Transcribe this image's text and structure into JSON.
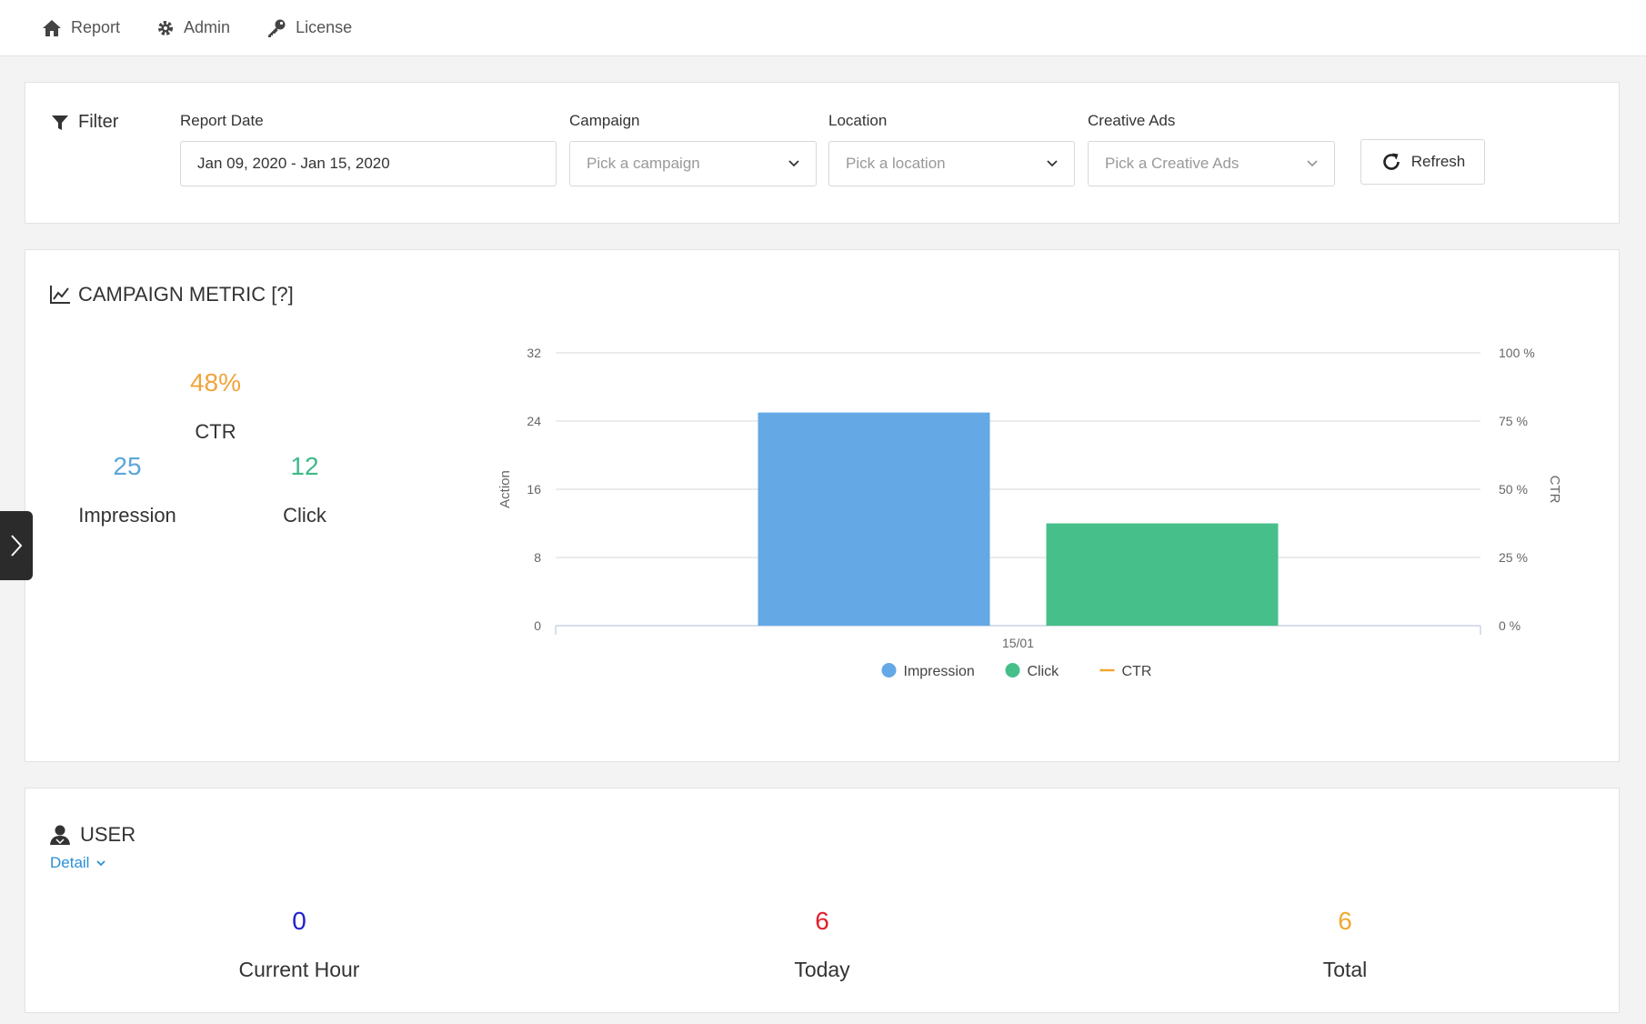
{
  "nav": {
    "items": [
      {
        "label": "Report",
        "icon": "home-icon"
      },
      {
        "label": "Admin",
        "icon": "gear-icon"
      },
      {
        "label": "License",
        "icon": "key-icon"
      }
    ]
  },
  "filter": {
    "title": "Filter",
    "report_date": {
      "label": "Report Date",
      "value": "Jan 09, 2020 - Jan 15, 2020"
    },
    "campaign": {
      "label": "Campaign",
      "placeholder": "Pick a campaign"
    },
    "location": {
      "label": "Location",
      "placeholder": "Pick a location"
    },
    "creative_ads": {
      "label": "Creative Ads",
      "placeholder": "Pick a Creative Ads"
    },
    "refresh_label": "Refresh"
  },
  "campaign_metric": {
    "title": "CAMPAIGN METRIC [?]",
    "ctr_value": "48%",
    "ctr_label": "CTR",
    "impression_value": "25",
    "impression_label": "Impression",
    "click_value": "12",
    "click_label": "Click"
  },
  "chart_data": {
    "type": "bar",
    "categories": [
      "15/01"
    ],
    "series": [
      {
        "name": "Impression",
        "values": [
          25
        ],
        "color": "#64a8e6"
      },
      {
        "name": "Click",
        "values": [
          12
        ],
        "color": "#47bf8a"
      },
      {
        "name": "CTR",
        "values": [
          48
        ],
        "color": "#f0a830",
        "axis": "right"
      }
    ],
    "ylabel": "Action",
    "y2label": "CTR",
    "ylim": [
      0,
      32
    ],
    "yticks": [
      "0",
      "8",
      "16",
      "24",
      "32"
    ],
    "y2ticks": [
      "0 %",
      "25 %",
      "50 %",
      "75 %",
      "100 %"
    ],
    "grid": true,
    "legend_position": "bottom"
  },
  "user": {
    "title": "USER",
    "detail_label": "Detail",
    "current_hour_value": "0",
    "current_hour_label": "Current Hour",
    "today_value": "6",
    "today_label": "Today",
    "total_value": "6",
    "total_label": "Total"
  },
  "colors": {
    "ctr": "#f0a43c",
    "impression": "#5aa6dc",
    "click": "#3fb98a",
    "current_hour": "#2222cc",
    "today": "#e0202e",
    "total": "#f0a830",
    "link": "#2a8fd8"
  }
}
